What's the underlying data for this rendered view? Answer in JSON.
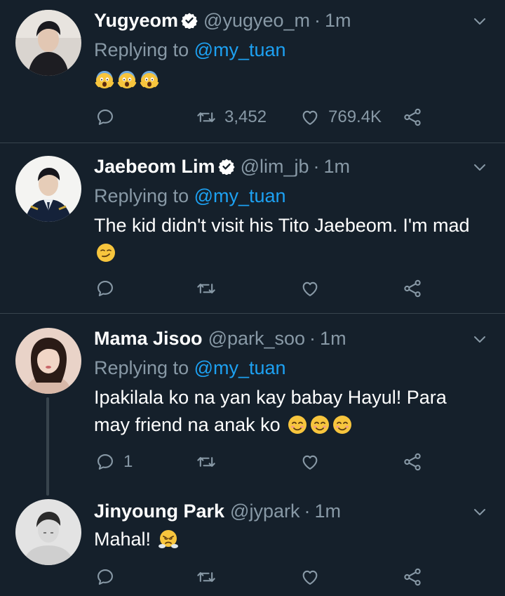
{
  "tweets": [
    {
      "name": "Yugyeom",
      "verified": true,
      "handle": "@yugyeo_m",
      "time": "1m",
      "replying_prefix": "Replying to",
      "replying_to": "@my_tuan",
      "text": "",
      "emojis": [
        "fearful-face-emoji",
        "fearful-face-emoji",
        "fearful-face-emoji"
      ],
      "reply_count": "",
      "retweet_count": "3,452",
      "like_count": "769.4K"
    },
    {
      "name": "Jaebeom Lim",
      "verified": true,
      "handle": "@lim_jb",
      "time": "1m",
      "replying_prefix": "Replying to",
      "replying_to": "@my_tuan",
      "text": "The kid didn't visit his Tito Jaebeom. I'm mad",
      "emojis": [
        "smirking-face-emoji"
      ],
      "reply_count": "",
      "retweet_count": "",
      "like_count": ""
    },
    {
      "name": "Mama Jisoo",
      "verified": false,
      "handle": "@park_soo",
      "time": "1m",
      "replying_prefix": "Replying to",
      "replying_to": "@my_tuan",
      "text": "Ipakilala ko na yan kay babay Hayul! Para may friend na anak ko",
      "emojis": [
        "smiling-face-emoji",
        "smiling-face-emoji",
        "smiling-face-emoji"
      ],
      "reply_count": "1",
      "retweet_count": "",
      "like_count": ""
    },
    {
      "name": "Jinyoung Park",
      "verified": false,
      "handle": "@jypark",
      "time": "1m",
      "text": "Mahal!",
      "emojis": [
        "steam-from-nose-emoji"
      ],
      "reply_count": "",
      "retweet_count": "",
      "like_count": ""
    }
  ],
  "separator": "·",
  "colors": {
    "background": "#15202b",
    "divider": "#38444d",
    "secondary_text": "#8899a6",
    "link": "#1da1f2",
    "verified_badge": "#ffffff"
  }
}
